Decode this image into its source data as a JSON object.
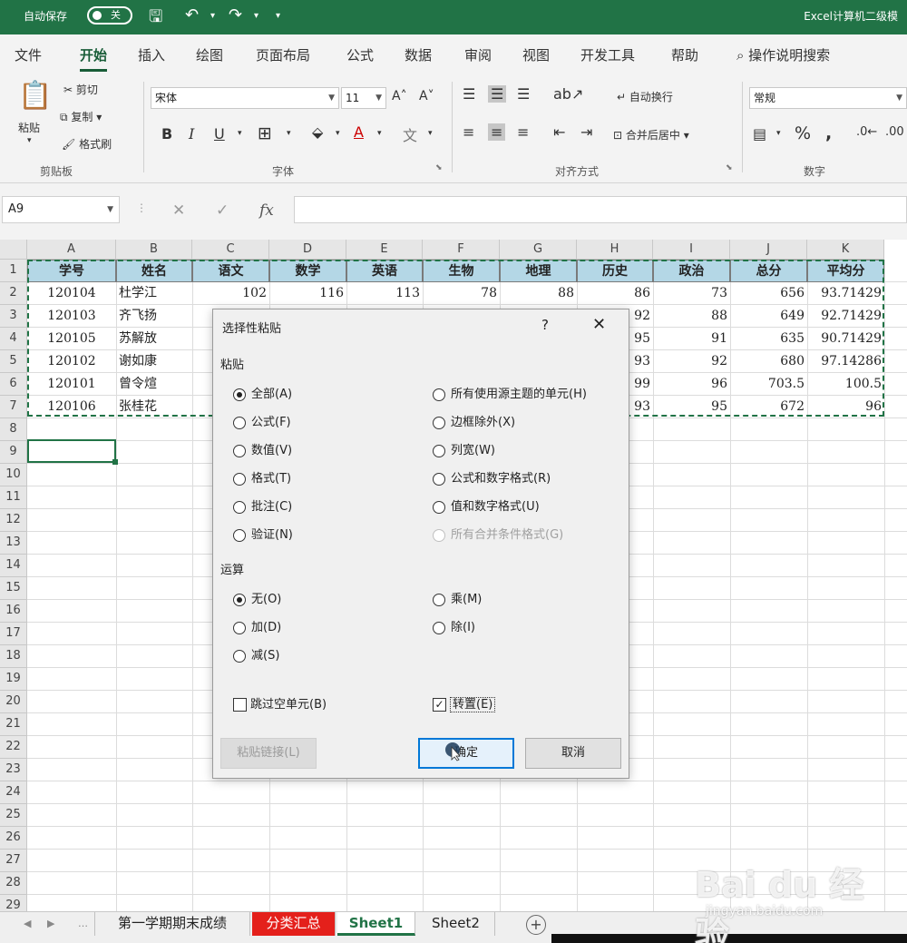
{
  "titlebar": {
    "autosave_label": "自动保存",
    "autosave_state": "关",
    "window_title": "Excel计算机二级模"
  },
  "ribbon_tabs": [
    "文件",
    "开始",
    "插入",
    "绘图",
    "页面布局",
    "公式",
    "数据",
    "审阅",
    "视图",
    "开发工具",
    "帮助"
  ],
  "active_tab": "开始",
  "search_label": "操作说明搜索",
  "ribbon": {
    "paste": "粘贴",
    "cut": "剪切",
    "copy": "复制",
    "format_painter": "格式刷",
    "clipboard_group": "剪贴板",
    "font_name": "宋体",
    "font_size": "11",
    "font_group": "字体",
    "wrap_text": "自动换行",
    "merge_center": "合并后居中",
    "align_group": "对齐方式",
    "number_format": "常规",
    "number_group": "数字"
  },
  "formula_bar": {
    "name_box": "A9",
    "fx": "fx",
    "formula": ""
  },
  "columns": [
    "A",
    "B",
    "C",
    "D",
    "E",
    "F",
    "G",
    "H",
    "I",
    "J",
    "K"
  ],
  "rows": [
    "1",
    "2",
    "3",
    "4",
    "5",
    "6",
    "7",
    "8",
    "9",
    "10",
    "11",
    "12",
    "13",
    "14",
    "15",
    "16",
    "17",
    "18",
    "19",
    "20",
    "21",
    "22",
    "23",
    "24",
    "25",
    "26",
    "27",
    "28",
    "29"
  ],
  "table": {
    "headers": [
      "学号",
      "姓名",
      "语文",
      "数学",
      "英语",
      "生物",
      "地理",
      "历史",
      "政治",
      "总分",
      "平均分"
    ],
    "rows": [
      [
        "120104",
        "杜学江",
        "102",
        "116",
        "113",
        "78",
        "88",
        "86",
        "73",
        "656",
        "93.71429"
      ],
      [
        "120103",
        "齐飞扬",
        "",
        "",
        "",
        "",
        "",
        "92",
        "88",
        "649",
        "92.71429"
      ],
      [
        "120105",
        "苏解放",
        "",
        "",
        "",
        "",
        "",
        "95",
        "91",
        "635",
        "90.71429"
      ],
      [
        "120102",
        "谢如康",
        "",
        "",
        "",
        "",
        "",
        "93",
        "92",
        "680",
        "97.14286"
      ],
      [
        "120101",
        "曾令煊",
        "",
        "",
        "",
        "",
        "",
        "99",
        "96",
        "703.5",
        "100.5"
      ],
      [
        "120106",
        "张桂花",
        "",
        "",
        "",
        "",
        "",
        "93",
        "95",
        "672",
        "96"
      ]
    ]
  },
  "dialog": {
    "title": "选择性粘贴",
    "help": "?",
    "close": "✕",
    "paste_section": "粘贴",
    "paste_options_left": [
      "全部(A)",
      "公式(F)",
      "数值(V)",
      "格式(T)",
      "批注(C)",
      "验证(N)"
    ],
    "paste_options_right": [
      "所有使用源主题的单元(H)",
      "边框除外(X)",
      "列宽(W)",
      "公式和数字格式(R)",
      "值和数字格式(U)",
      "所有合并条件格式(G)"
    ],
    "paste_selected": "全部(A)",
    "operation_section": "运算",
    "op_options_left": [
      "无(O)",
      "加(D)",
      "减(S)"
    ],
    "op_options_right": [
      "乘(M)",
      "除(I)"
    ],
    "op_selected": "无(O)",
    "skip_blanks": "跳过空单元(B)",
    "skip_blanks_checked": false,
    "transpose": "转置(E)",
    "transpose_checked": true,
    "paste_link": "粘贴链接(L)",
    "ok": "确定",
    "cancel": "取消"
  },
  "sheet_tabs": [
    "第一学期期末成绩",
    "分类汇总",
    "Sheet1",
    "Sheet2"
  ],
  "active_sheet": "Sheet1",
  "watermark": {
    "brand": "Bai du 经验",
    "url": "jingyan.baidu.com"
  },
  "colors": {
    "excel_green": "#217346",
    "header_fill": "#b4d7e6",
    "red_tab": "#e4201b",
    "ok_border": "#0078d7"
  }
}
